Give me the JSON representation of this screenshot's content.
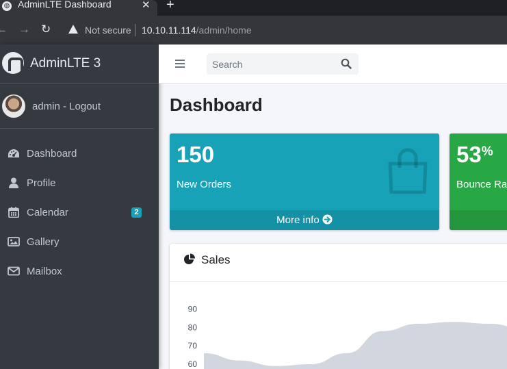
{
  "browser": {
    "tab_title": "AdminLTE Dashboard",
    "tab_close": "✕",
    "new_tab": "+",
    "security_label": "Not secure",
    "url_host": "10.10.11.114",
    "url_path": "/admin/home"
  },
  "sidebar": {
    "brand": "AdminLTE 3",
    "user": "admin - Logout",
    "items": [
      {
        "label": "Dashboard",
        "icon": "tachometer-icon"
      },
      {
        "label": "Profile",
        "icon": "user-icon"
      },
      {
        "label": "Calendar",
        "icon": "calendar-icon",
        "badge": "2"
      },
      {
        "label": "Gallery",
        "icon": "image-icon"
      },
      {
        "label": "Mailbox",
        "icon": "envelope-icon"
      }
    ]
  },
  "header": {
    "search_placeholder": "Search"
  },
  "main": {
    "title": "Dashboard",
    "boxes": [
      {
        "value": "150",
        "label": "New Orders",
        "footer": "More info",
        "color": "#17a2b8"
      },
      {
        "value": "53",
        "unit": "%",
        "label": "Bounce Rat",
        "color": "#28a745"
      }
    ],
    "sales_card": {
      "title": "Sales",
      "y_ticks": [
        "90",
        "80",
        "70",
        "60"
      ]
    }
  },
  "chart_data": {
    "type": "area",
    "title": "Sales",
    "y_ticks": [
      90,
      80,
      70,
      60
    ],
    "ylim": [
      60,
      95
    ],
    "fill_color": "#d2d6de",
    "series": [
      {
        "values": [
          66,
          62,
          59,
          60,
          66,
          78,
          82,
          83,
          82,
          79
        ]
      }
    ]
  }
}
